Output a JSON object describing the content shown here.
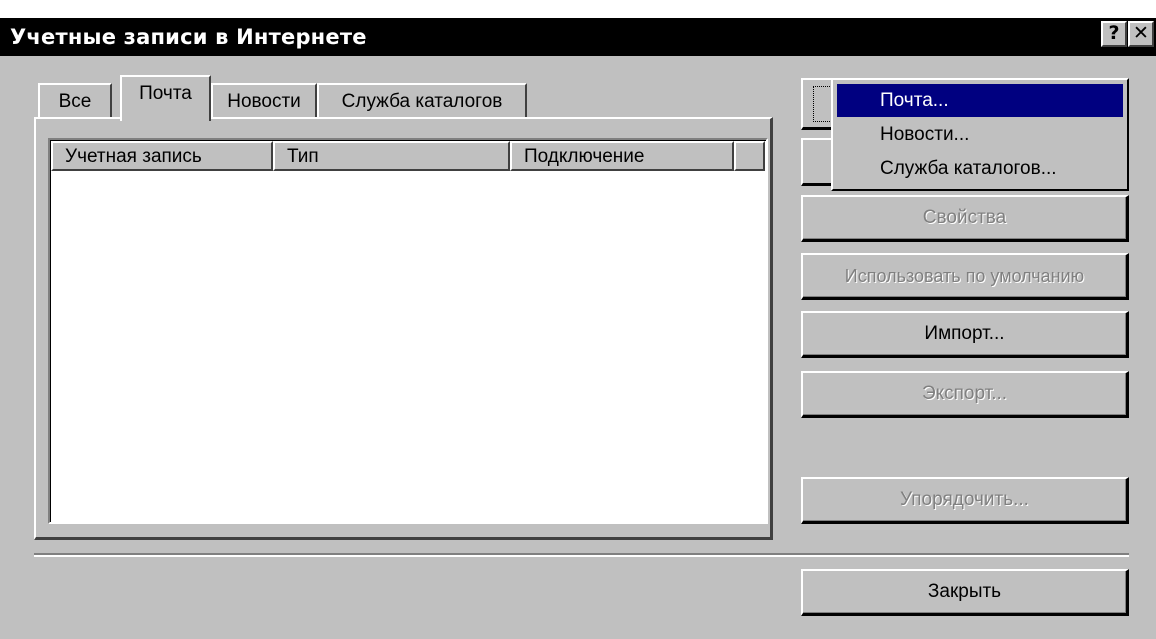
{
  "window": {
    "title": "Учетные записи в Интернете",
    "help_button": "?",
    "close_button": "✕"
  },
  "tabs": [
    {
      "label": "Все",
      "active": false
    },
    {
      "label": "Почта",
      "active": true
    },
    {
      "label": "Новости",
      "active": false
    },
    {
      "label": "Служба каталогов",
      "active": false
    }
  ],
  "list": {
    "columns": [
      "Учетная запись",
      "Тип",
      "Подключение"
    ],
    "rows": []
  },
  "buttons": {
    "properties": "Свойства",
    "set_default": "Использовать по умолчанию",
    "import": "Импорт...",
    "export": "Экспорт...",
    "order": "Упорядочить...",
    "close": "Закрыть"
  },
  "add_menu": {
    "items": [
      "Почта...",
      "Новости...",
      "Служба каталогов..."
    ],
    "selected_index": 0
  },
  "colors": {
    "window_bg": "#c0c0c0",
    "titlebar": "#000000",
    "menu_highlight": "#000080"
  }
}
